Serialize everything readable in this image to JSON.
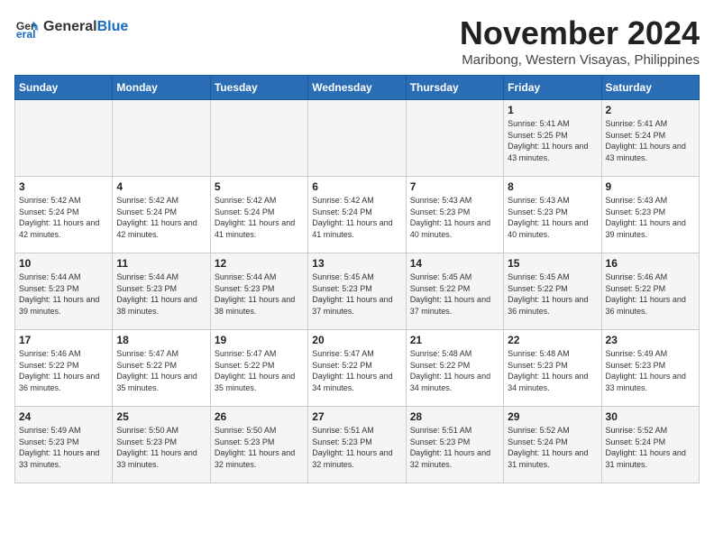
{
  "header": {
    "logo_general": "General",
    "logo_blue": "Blue",
    "month_title": "November 2024",
    "location": "Maribong, Western Visayas, Philippines"
  },
  "weekdays": [
    "Sunday",
    "Monday",
    "Tuesday",
    "Wednesday",
    "Thursday",
    "Friday",
    "Saturday"
  ],
  "weeks": [
    [
      {
        "day": "",
        "info": ""
      },
      {
        "day": "",
        "info": ""
      },
      {
        "day": "",
        "info": ""
      },
      {
        "day": "",
        "info": ""
      },
      {
        "day": "",
        "info": ""
      },
      {
        "day": "1",
        "info": "Sunrise: 5:41 AM\nSunset: 5:25 PM\nDaylight: 11 hours and 43 minutes."
      },
      {
        "day": "2",
        "info": "Sunrise: 5:41 AM\nSunset: 5:24 PM\nDaylight: 11 hours and 43 minutes."
      }
    ],
    [
      {
        "day": "3",
        "info": "Sunrise: 5:42 AM\nSunset: 5:24 PM\nDaylight: 11 hours and 42 minutes."
      },
      {
        "day": "4",
        "info": "Sunrise: 5:42 AM\nSunset: 5:24 PM\nDaylight: 11 hours and 42 minutes."
      },
      {
        "day": "5",
        "info": "Sunrise: 5:42 AM\nSunset: 5:24 PM\nDaylight: 11 hours and 41 minutes."
      },
      {
        "day": "6",
        "info": "Sunrise: 5:42 AM\nSunset: 5:24 PM\nDaylight: 11 hours and 41 minutes."
      },
      {
        "day": "7",
        "info": "Sunrise: 5:43 AM\nSunset: 5:23 PM\nDaylight: 11 hours and 40 minutes."
      },
      {
        "day": "8",
        "info": "Sunrise: 5:43 AM\nSunset: 5:23 PM\nDaylight: 11 hours and 40 minutes."
      },
      {
        "day": "9",
        "info": "Sunrise: 5:43 AM\nSunset: 5:23 PM\nDaylight: 11 hours and 39 minutes."
      }
    ],
    [
      {
        "day": "10",
        "info": "Sunrise: 5:44 AM\nSunset: 5:23 PM\nDaylight: 11 hours and 39 minutes."
      },
      {
        "day": "11",
        "info": "Sunrise: 5:44 AM\nSunset: 5:23 PM\nDaylight: 11 hours and 38 minutes."
      },
      {
        "day": "12",
        "info": "Sunrise: 5:44 AM\nSunset: 5:23 PM\nDaylight: 11 hours and 38 minutes."
      },
      {
        "day": "13",
        "info": "Sunrise: 5:45 AM\nSunset: 5:23 PM\nDaylight: 11 hours and 37 minutes."
      },
      {
        "day": "14",
        "info": "Sunrise: 5:45 AM\nSunset: 5:22 PM\nDaylight: 11 hours and 37 minutes."
      },
      {
        "day": "15",
        "info": "Sunrise: 5:45 AM\nSunset: 5:22 PM\nDaylight: 11 hours and 36 minutes."
      },
      {
        "day": "16",
        "info": "Sunrise: 5:46 AM\nSunset: 5:22 PM\nDaylight: 11 hours and 36 minutes."
      }
    ],
    [
      {
        "day": "17",
        "info": "Sunrise: 5:46 AM\nSunset: 5:22 PM\nDaylight: 11 hours and 36 minutes."
      },
      {
        "day": "18",
        "info": "Sunrise: 5:47 AM\nSunset: 5:22 PM\nDaylight: 11 hours and 35 minutes."
      },
      {
        "day": "19",
        "info": "Sunrise: 5:47 AM\nSunset: 5:22 PM\nDaylight: 11 hours and 35 minutes."
      },
      {
        "day": "20",
        "info": "Sunrise: 5:47 AM\nSunset: 5:22 PM\nDaylight: 11 hours and 34 minutes."
      },
      {
        "day": "21",
        "info": "Sunrise: 5:48 AM\nSunset: 5:22 PM\nDaylight: 11 hours and 34 minutes."
      },
      {
        "day": "22",
        "info": "Sunrise: 5:48 AM\nSunset: 5:23 PM\nDaylight: 11 hours and 34 minutes."
      },
      {
        "day": "23",
        "info": "Sunrise: 5:49 AM\nSunset: 5:23 PM\nDaylight: 11 hours and 33 minutes."
      }
    ],
    [
      {
        "day": "24",
        "info": "Sunrise: 5:49 AM\nSunset: 5:23 PM\nDaylight: 11 hours and 33 minutes."
      },
      {
        "day": "25",
        "info": "Sunrise: 5:50 AM\nSunset: 5:23 PM\nDaylight: 11 hours and 33 minutes."
      },
      {
        "day": "26",
        "info": "Sunrise: 5:50 AM\nSunset: 5:23 PM\nDaylight: 11 hours and 32 minutes."
      },
      {
        "day": "27",
        "info": "Sunrise: 5:51 AM\nSunset: 5:23 PM\nDaylight: 11 hours and 32 minutes."
      },
      {
        "day": "28",
        "info": "Sunrise: 5:51 AM\nSunset: 5:23 PM\nDaylight: 11 hours and 32 minutes."
      },
      {
        "day": "29",
        "info": "Sunrise: 5:52 AM\nSunset: 5:24 PM\nDaylight: 11 hours and 31 minutes."
      },
      {
        "day": "30",
        "info": "Sunrise: 5:52 AM\nSunset: 5:24 PM\nDaylight: 11 hours and 31 minutes."
      }
    ]
  ]
}
